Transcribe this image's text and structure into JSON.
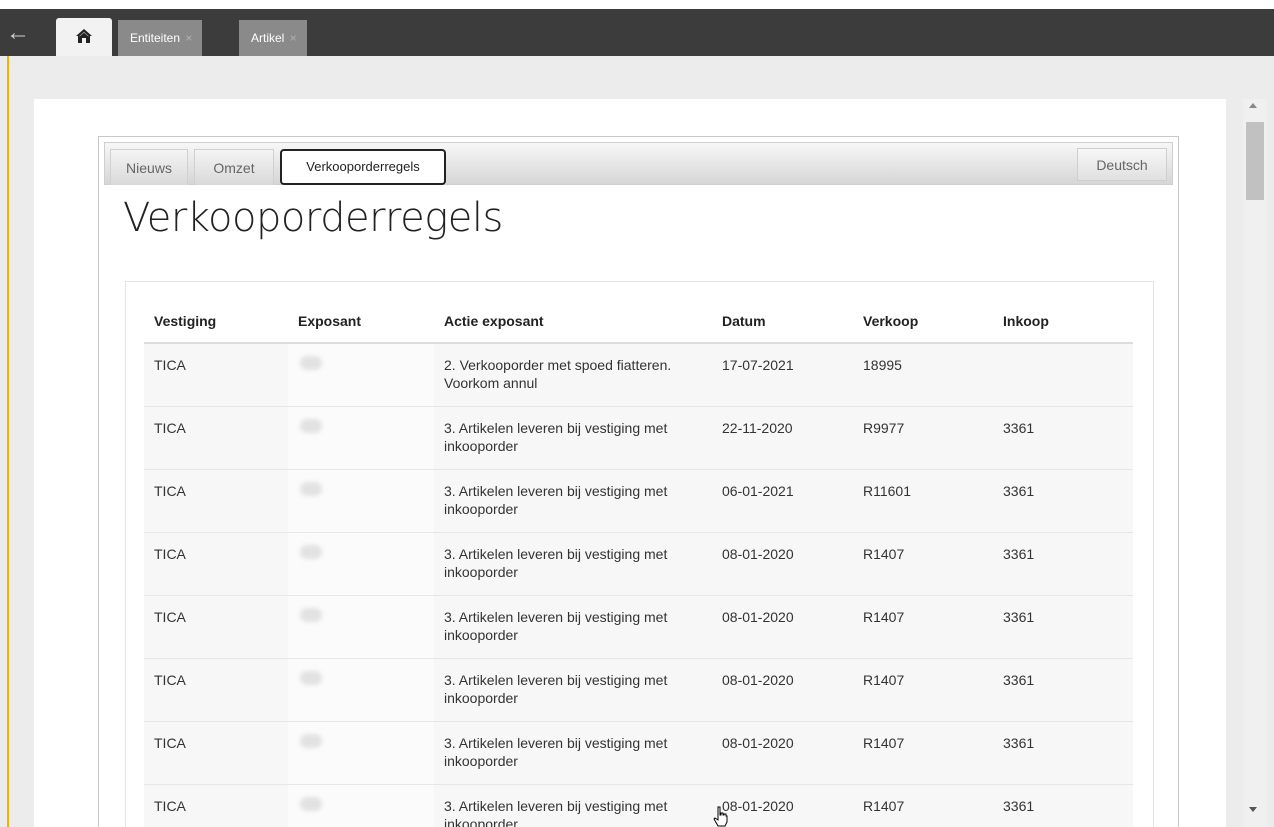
{
  "topbar": {
    "back_icon": "arrow-left-icon",
    "home_icon": "home-icon",
    "tabs": [
      {
        "label": "Entiteiten",
        "close": "×"
      },
      {
        "label": "Artikel",
        "close": "×"
      }
    ]
  },
  "panel_tabs": [
    {
      "label": "Nieuws"
    },
    {
      "label": "Omzet"
    },
    {
      "label": "Verkooporderregels"
    }
  ],
  "language_button": "Deutsch",
  "page_title": "Verkooporderregels",
  "table": {
    "headers": [
      "Vestiging",
      "Exposant",
      "Actie exposant",
      "Datum",
      "Verkoop",
      "Inkoop"
    ],
    "rows": [
      {
        "vestiging": "TICA",
        "actie_1": "2. Verkooporder met spoed fiatteren.",
        "actie_2": "Voorkom annul",
        "datum": "17-07-2021",
        "verkoop": "18995",
        "inkoop": ""
      },
      {
        "vestiging": "TICA",
        "actie_1": "3. Artikelen leveren bij vestiging met",
        "actie_2": "inkooporder",
        "datum": "22-11-2020",
        "verkoop": "R9977",
        "inkoop": "3361"
      },
      {
        "vestiging": "TICA",
        "actie_1": "3. Artikelen leveren bij vestiging met",
        "actie_2": "inkooporder",
        "datum": "06-01-2021",
        "verkoop": "R11601",
        "inkoop": "3361"
      },
      {
        "vestiging": "TICA",
        "actie_1": "3. Artikelen leveren bij vestiging met",
        "actie_2": "inkooporder",
        "datum": "08-01-2020",
        "verkoop": "R1407",
        "inkoop": "3361"
      },
      {
        "vestiging": "TICA",
        "actie_1": "3. Artikelen leveren bij vestiging met",
        "actie_2": "inkooporder",
        "datum": "08-01-2020",
        "verkoop": "R1407",
        "inkoop": "3361"
      },
      {
        "vestiging": "TICA",
        "actie_1": "3. Artikelen leveren bij vestiging met",
        "actie_2": "inkooporder",
        "datum": "08-01-2020",
        "verkoop": "R1407",
        "inkoop": "3361"
      },
      {
        "vestiging": "TICA",
        "actie_1": "3. Artikelen leveren bij vestiging met",
        "actie_2": "inkooporder",
        "datum": "08-01-2020",
        "verkoop": "R1407",
        "inkoop": "3361"
      },
      {
        "vestiging": "TICA",
        "actie_1": "3. Artikelen leveren bij vestiging met",
        "actie_2": "inkooporder",
        "datum": "08-01-2020",
        "verkoop": "R1407",
        "inkoop": "3361"
      }
    ]
  },
  "colors": {
    "topbar": "#3c3c3c",
    "tab_gray": "#8a8a8a",
    "accent_yellow": "#f2b200"
  }
}
